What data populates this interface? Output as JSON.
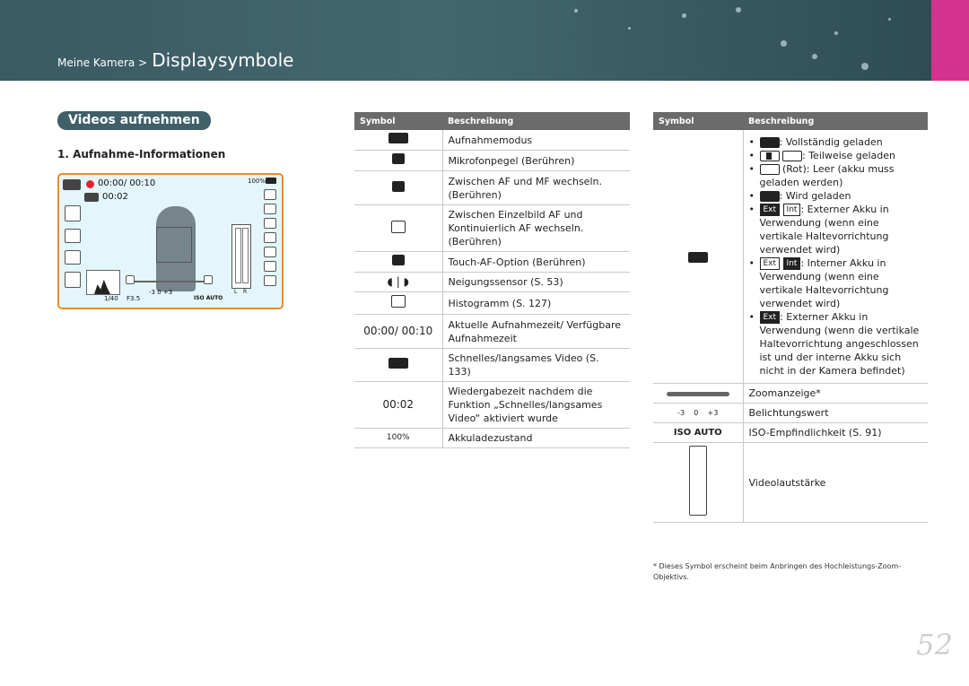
{
  "header": {
    "crumb_small": "Meine Kamera >",
    "crumb_big": "Displaysymbole"
  },
  "section": {
    "title": "Videos aufnehmen",
    "subtitle": "1. Aufnahme-Informationen"
  },
  "screen": {
    "rec_time": "00:00/ 00:10",
    "slow_time": "00:02",
    "battery": "100%",
    "shutter": "1/40",
    "aperture": "F3.5",
    "exposure_scale": "-3    0    +3",
    "iso": "ISO AUTO",
    "volume_l": "L",
    "volume_r": "R"
  },
  "table_left": {
    "col_symbol": "Symbol",
    "col_desc": "Beschreibung",
    "rows": [
      {
        "symbol": "",
        "desc": "Aufnahmemodus"
      },
      {
        "symbol": "",
        "desc": "Mikrofonpegel (Berühren)"
      },
      {
        "symbol": "",
        "desc": "Zwischen AF und MF wechseln. (Berühren)"
      },
      {
        "symbol": "",
        "desc": "Zwischen Einzelbild AF und Kontinuierlich AF wechseln. (Berühren)"
      },
      {
        "symbol": "",
        "desc": "Touch-AF-Option (Berühren)"
      },
      {
        "symbol": "",
        "desc": "Neigungssensor (S. 53)"
      },
      {
        "symbol": "",
        "desc": "Histogramm (S. 127)"
      },
      {
        "symbol": "00:00/ 00:10",
        "desc": "Aktuelle Aufnahmezeit/ Verfügbare Aufnahmezeit"
      },
      {
        "symbol": "",
        "desc": "Schnelles/langsames Video (S. 133)"
      },
      {
        "symbol": "00:02",
        "desc": "Wiedergabezeit nachdem die Funktion „Schnelles/langsames Video“ aktiviert wurde"
      },
      {
        "symbol": "100%",
        "desc": "Akkuladezustand"
      }
    ]
  },
  "table_right": {
    "col_symbol": "Symbol",
    "col_desc": "Beschreibung",
    "battery_items": [
      ": Vollständig geladen",
      ": Teilweise geladen",
      " (Rot): Leer (akku muss geladen werden)",
      ": Wird geladen",
      ": Externer Akku in Verwendung (wenn eine vertikale Haltevorrichtung verwendet wird)",
      ": Interner Akku in Verwendung (wenn eine vertikale Haltevorrichtung verwendet wird)",
      ": Externer Akku in Verwendung (wenn die vertikale Haltevorrichtung angeschlossen ist und der interne Akku sich nicht in der Kamera befindet)"
    ],
    "ext_label": "Ext",
    "int_label": "Int",
    "rows": [
      {
        "symbol": "",
        "desc": "Zoomanzeige*"
      },
      {
        "symbol": "-3    0    +3",
        "desc": "Belichtungswert"
      },
      {
        "symbol": "ISO AUTO",
        "desc": "ISO-Empfindlichkeit (S. 91)"
      },
      {
        "symbol": "",
        "desc": "Videolautstärke"
      }
    ]
  },
  "footnote": "* Dieses Symbol erscheint beim Anbringen des Hochleistungs-Zoom-Objektivs.",
  "page_number": "52"
}
